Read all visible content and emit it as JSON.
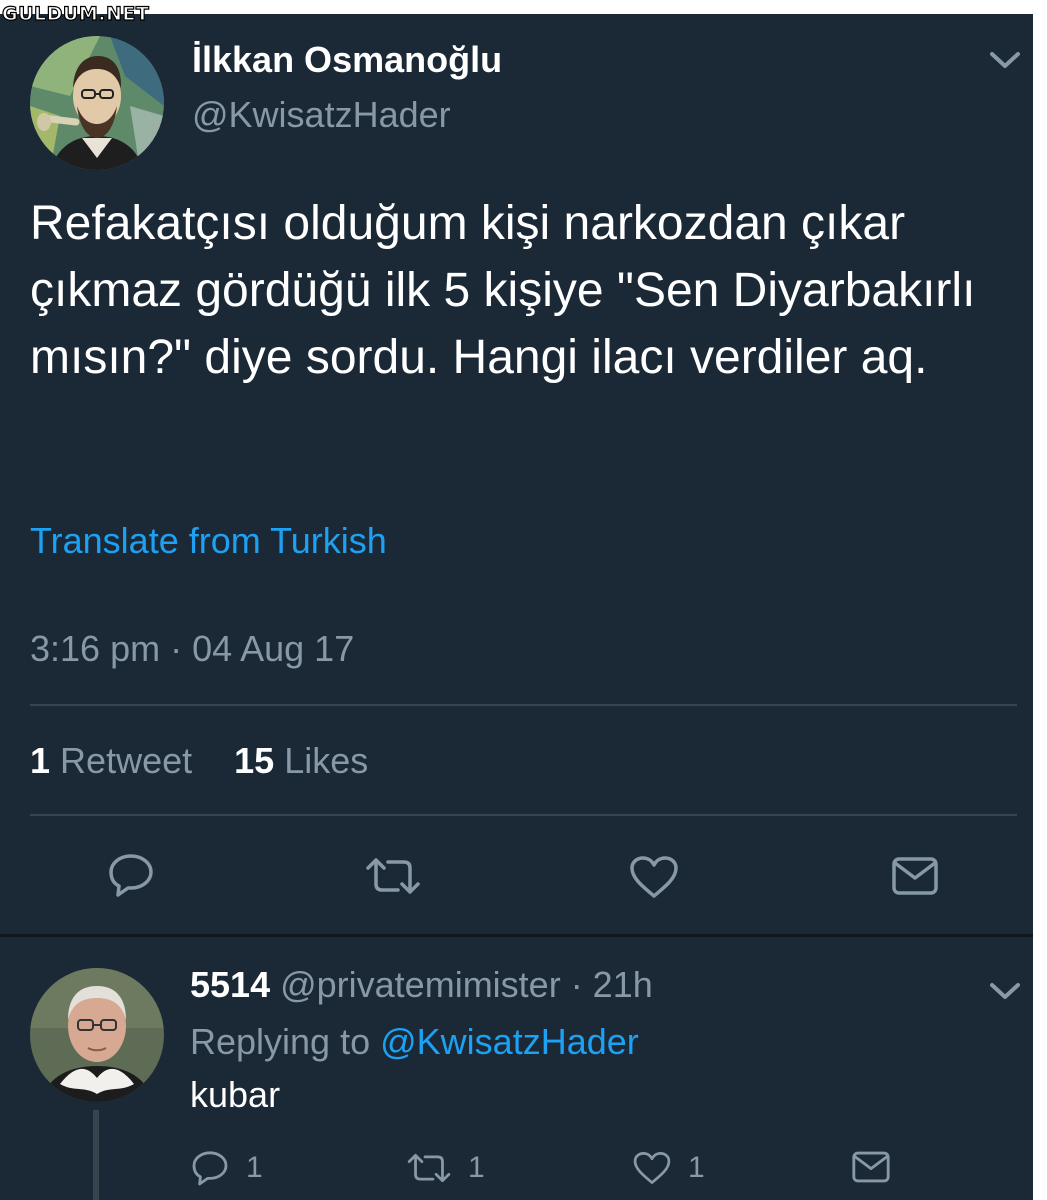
{
  "watermark": "GULDUM.NET",
  "tweet": {
    "author_name": "İlkkan Osmanoğlu",
    "author_handle": "@KwisatzHader",
    "text": "Refakatçısı olduğum kişi narkozdan çıkar çıkmaz gördüğü ilk 5 kişiye \"Sen Diyarbakırlı mısın?\" diye sordu. Hangi ilacı verdiler aq.",
    "translate_link": "Translate from Turkish",
    "timestamp": "3:16 pm · 04 Aug 17",
    "retweet_count": "1",
    "retweet_label": "Retweet",
    "like_count": "15",
    "like_label": "Likes",
    "actions": [
      "reply-icon",
      "retweet-icon",
      "like-icon",
      "share-icon"
    ]
  },
  "reply": {
    "name": "5514",
    "handle_time": "@privatemimister · 21h",
    "replying_label": "Replying to",
    "replying_handle": "@KwisatzHader",
    "text": "kubar",
    "reply_count": "1",
    "retweet_count": "1",
    "like_count": "1"
  },
  "colors": {
    "background": "#1b2836",
    "text_primary": "#ffffff",
    "text_secondary": "#8899a6",
    "accent": "#1da1f2",
    "divider": "#38444d"
  }
}
